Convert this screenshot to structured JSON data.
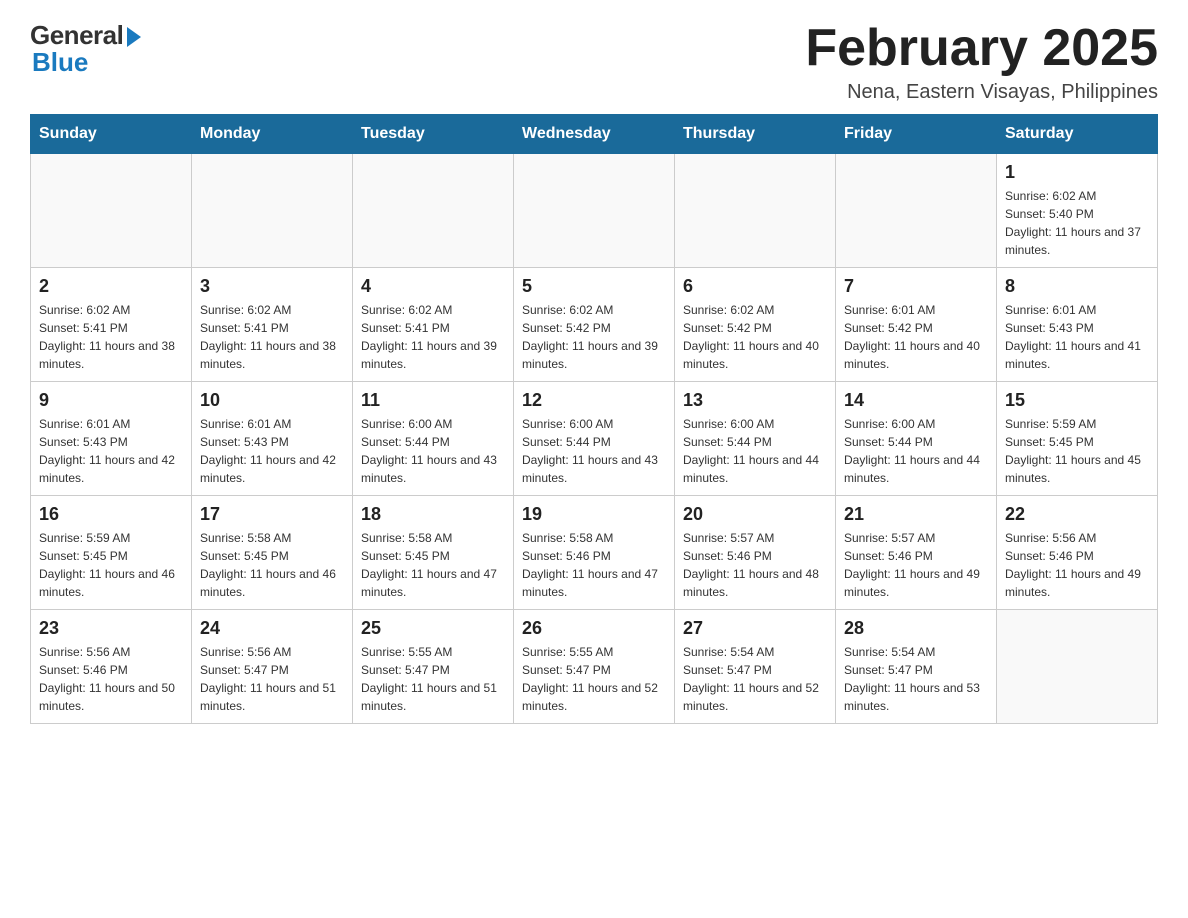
{
  "logo": {
    "general": "General",
    "blue": "Blue"
  },
  "title": "February 2025",
  "subtitle": "Nena, Eastern Visayas, Philippines",
  "days_of_week": [
    "Sunday",
    "Monday",
    "Tuesday",
    "Wednesday",
    "Thursday",
    "Friday",
    "Saturday"
  ],
  "weeks": [
    [
      {
        "day": "",
        "info": ""
      },
      {
        "day": "",
        "info": ""
      },
      {
        "day": "",
        "info": ""
      },
      {
        "day": "",
        "info": ""
      },
      {
        "day": "",
        "info": ""
      },
      {
        "day": "",
        "info": ""
      },
      {
        "day": "1",
        "info": "Sunrise: 6:02 AM\nSunset: 5:40 PM\nDaylight: 11 hours and 37 minutes."
      }
    ],
    [
      {
        "day": "2",
        "info": "Sunrise: 6:02 AM\nSunset: 5:41 PM\nDaylight: 11 hours and 38 minutes."
      },
      {
        "day": "3",
        "info": "Sunrise: 6:02 AM\nSunset: 5:41 PM\nDaylight: 11 hours and 38 minutes."
      },
      {
        "day": "4",
        "info": "Sunrise: 6:02 AM\nSunset: 5:41 PM\nDaylight: 11 hours and 39 minutes."
      },
      {
        "day": "5",
        "info": "Sunrise: 6:02 AM\nSunset: 5:42 PM\nDaylight: 11 hours and 39 minutes."
      },
      {
        "day": "6",
        "info": "Sunrise: 6:02 AM\nSunset: 5:42 PM\nDaylight: 11 hours and 40 minutes."
      },
      {
        "day": "7",
        "info": "Sunrise: 6:01 AM\nSunset: 5:42 PM\nDaylight: 11 hours and 40 minutes."
      },
      {
        "day": "8",
        "info": "Sunrise: 6:01 AM\nSunset: 5:43 PM\nDaylight: 11 hours and 41 minutes."
      }
    ],
    [
      {
        "day": "9",
        "info": "Sunrise: 6:01 AM\nSunset: 5:43 PM\nDaylight: 11 hours and 42 minutes."
      },
      {
        "day": "10",
        "info": "Sunrise: 6:01 AM\nSunset: 5:43 PM\nDaylight: 11 hours and 42 minutes."
      },
      {
        "day": "11",
        "info": "Sunrise: 6:00 AM\nSunset: 5:44 PM\nDaylight: 11 hours and 43 minutes."
      },
      {
        "day": "12",
        "info": "Sunrise: 6:00 AM\nSunset: 5:44 PM\nDaylight: 11 hours and 43 minutes."
      },
      {
        "day": "13",
        "info": "Sunrise: 6:00 AM\nSunset: 5:44 PM\nDaylight: 11 hours and 44 minutes."
      },
      {
        "day": "14",
        "info": "Sunrise: 6:00 AM\nSunset: 5:44 PM\nDaylight: 11 hours and 44 minutes."
      },
      {
        "day": "15",
        "info": "Sunrise: 5:59 AM\nSunset: 5:45 PM\nDaylight: 11 hours and 45 minutes."
      }
    ],
    [
      {
        "day": "16",
        "info": "Sunrise: 5:59 AM\nSunset: 5:45 PM\nDaylight: 11 hours and 46 minutes."
      },
      {
        "day": "17",
        "info": "Sunrise: 5:58 AM\nSunset: 5:45 PM\nDaylight: 11 hours and 46 minutes."
      },
      {
        "day": "18",
        "info": "Sunrise: 5:58 AM\nSunset: 5:45 PM\nDaylight: 11 hours and 47 minutes."
      },
      {
        "day": "19",
        "info": "Sunrise: 5:58 AM\nSunset: 5:46 PM\nDaylight: 11 hours and 47 minutes."
      },
      {
        "day": "20",
        "info": "Sunrise: 5:57 AM\nSunset: 5:46 PM\nDaylight: 11 hours and 48 minutes."
      },
      {
        "day": "21",
        "info": "Sunrise: 5:57 AM\nSunset: 5:46 PM\nDaylight: 11 hours and 49 minutes."
      },
      {
        "day": "22",
        "info": "Sunrise: 5:56 AM\nSunset: 5:46 PM\nDaylight: 11 hours and 49 minutes."
      }
    ],
    [
      {
        "day": "23",
        "info": "Sunrise: 5:56 AM\nSunset: 5:46 PM\nDaylight: 11 hours and 50 minutes."
      },
      {
        "day": "24",
        "info": "Sunrise: 5:56 AM\nSunset: 5:47 PM\nDaylight: 11 hours and 51 minutes."
      },
      {
        "day": "25",
        "info": "Sunrise: 5:55 AM\nSunset: 5:47 PM\nDaylight: 11 hours and 51 minutes."
      },
      {
        "day": "26",
        "info": "Sunrise: 5:55 AM\nSunset: 5:47 PM\nDaylight: 11 hours and 52 minutes."
      },
      {
        "day": "27",
        "info": "Sunrise: 5:54 AM\nSunset: 5:47 PM\nDaylight: 11 hours and 52 minutes."
      },
      {
        "day": "28",
        "info": "Sunrise: 5:54 AM\nSunset: 5:47 PM\nDaylight: 11 hours and 53 minutes."
      },
      {
        "day": "",
        "info": ""
      }
    ]
  ]
}
